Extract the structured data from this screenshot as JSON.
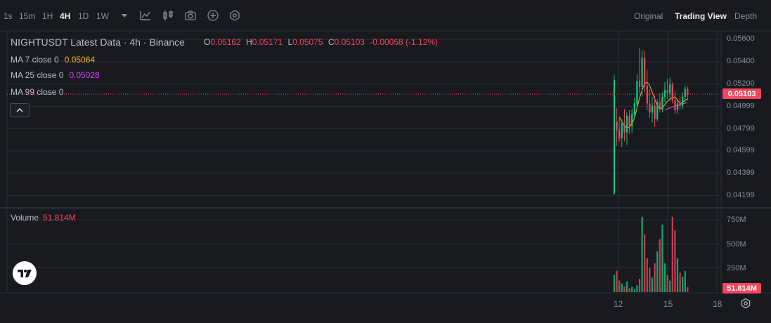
{
  "toolbar": {
    "intervals": [
      "1s",
      "15m",
      "1H",
      "4H",
      "1D",
      "1W"
    ],
    "active_interval": "4H",
    "views": [
      "Original",
      "Trading View",
      "Depth"
    ],
    "active_view": "Trading View"
  },
  "legend": {
    "title": "NIGHTUSDT Latest Data · 4h · Binance",
    "open_label": "O",
    "open": "0.05162",
    "high_label": "H",
    "high": "0.05171",
    "low_label": "L",
    "low": "0.05075",
    "close_label": "C",
    "close": "0.05103",
    "change": "-0.00058 (-1.12%)",
    "ma7_label": "MA 7 close 0",
    "ma7_value": "0.05064",
    "ma7_color": "#f0b90b",
    "ma25_label": "MA 25 close 0",
    "ma25_value": "0.05028",
    "ma25_color": "#e040fb",
    "ma99_label": "MA 99 close 0"
  },
  "price_axis": {
    "labels": [
      "0.05600",
      "0.05400",
      "0.05200",
      "0.04999",
      "0.04799",
      "0.04599",
      "0.04399",
      "0.04199"
    ],
    "current": "0.05103"
  },
  "volume": {
    "legend_label": "Volume",
    "legend_value": "51.814M",
    "axis_labels": [
      "750M",
      "500M",
      "250M"
    ],
    "current": "51.814M"
  },
  "time_axis": {
    "labels": [
      "12",
      "15",
      "18"
    ]
  },
  "colors": {
    "up": "#0ecb81",
    "down": "#f6465d",
    "background": "#181a20",
    "grid": "#2b2f36"
  },
  "chart_data": {
    "type": "candlestick",
    "candles": [
      {
        "o": 0.0421,
        "h": 0.0528,
        "l": 0.0421,
        "c": 0.0523
      },
      {
        "o": 0.0486,
        "h": 0.0498,
        "l": 0.0464,
        "c": 0.0478
      },
      {
        "o": 0.0478,
        "h": 0.0489,
        "l": 0.0468,
        "c": 0.0471
      },
      {
        "o": 0.0471,
        "h": 0.0488,
        "l": 0.0463,
        "c": 0.0484
      },
      {
        "o": 0.0484,
        "h": 0.0497,
        "l": 0.0468,
        "c": 0.0476
      },
      {
        "o": 0.0476,
        "h": 0.0494,
        "l": 0.0465,
        "c": 0.0491
      },
      {
        "o": 0.0491,
        "h": 0.0496,
        "l": 0.0475,
        "c": 0.0482
      },
      {
        "o": 0.0482,
        "h": 0.0497,
        "l": 0.0476,
        "c": 0.0493
      },
      {
        "o": 0.0493,
        "h": 0.0507,
        "l": 0.0489,
        "c": 0.0502
      },
      {
        "o": 0.0502,
        "h": 0.0528,
        "l": 0.0497,
        "c": 0.0522
      },
      {
        "o": 0.0522,
        "h": 0.0552,
        "l": 0.0511,
        "c": 0.0517
      },
      {
        "o": 0.0517,
        "h": 0.055,
        "l": 0.0508,
        "c": 0.0543
      },
      {
        "o": 0.0543,
        "h": 0.0549,
        "l": 0.0512,
        "c": 0.0518
      },
      {
        "o": 0.0518,
        "h": 0.0532,
        "l": 0.0496,
        "c": 0.0502
      },
      {
        "o": 0.0502,
        "h": 0.0515,
        "l": 0.0489,
        "c": 0.0494
      },
      {
        "o": 0.0494,
        "h": 0.0508,
        "l": 0.0485,
        "c": 0.05
      },
      {
        "o": 0.05,
        "h": 0.0509,
        "l": 0.0481,
        "c": 0.0488
      },
      {
        "o": 0.0488,
        "h": 0.0506,
        "l": 0.0486,
        "c": 0.0503
      },
      {
        "o": 0.0503,
        "h": 0.0511,
        "l": 0.0494,
        "c": 0.0497
      },
      {
        "o": 0.0497,
        "h": 0.0512,
        "l": 0.0494,
        "c": 0.0508
      },
      {
        "o": 0.0508,
        "h": 0.0521,
        "l": 0.0503,
        "c": 0.0514
      },
      {
        "o": 0.0514,
        "h": 0.0524,
        "l": 0.0506,
        "c": 0.0511
      },
      {
        "o": 0.0511,
        "h": 0.0525,
        "l": 0.0504,
        "c": 0.0519
      },
      {
        "o": 0.0519,
        "h": 0.0521,
        "l": 0.0502,
        "c": 0.0505
      },
      {
        "o": 0.0505,
        "h": 0.0513,
        "l": 0.0493,
        "c": 0.0496
      },
      {
        "o": 0.0496,
        "h": 0.0506,
        "l": 0.0493,
        "c": 0.0502
      },
      {
        "o": 0.0502,
        "h": 0.0509,
        "l": 0.0497,
        "c": 0.05
      },
      {
        "o": 0.05,
        "h": 0.0512,
        "l": 0.0497,
        "c": 0.0508
      },
      {
        "o": 0.0508,
        "h": 0.0518,
        "l": 0.0503,
        "c": 0.0515
      },
      {
        "o": 0.0515,
        "h": 0.0517,
        "l": 0.0505,
        "c": 0.051
      }
    ],
    "volume_millions": [
      180,
      220,
      120,
      90,
      60,
      110,
      40,
      55,
      30,
      70,
      140,
      780,
      600,
      350,
      250,
      150,
      300,
      420,
      550,
      700,
      300,
      180,
      120,
      780,
      640,
      350,
      200,
      160,
      220,
      52
    ],
    "ma7": [
      0.049,
      0.0486,
      0.0482,
      0.048,
      0.0481,
      0.0484,
      0.0489,
      0.0498,
      0.0507,
      0.0514,
      0.052,
      0.0521,
      0.0518,
      0.0512,
      0.0506,
      0.05,
      0.0497,
      0.0498,
      0.0501,
      0.0504,
      0.0506,
      0.0507,
      0.0508,
      0.0505,
      0.0502,
      0.0503,
      0.0505,
      0.0506
    ],
    "ma25": [
      0.0497,
      0.0497,
      0.0498,
      0.0499,
      0.05,
      0.05,
      0.0501,
      0.0502,
      0.0502,
      0.0503
    ]
  }
}
